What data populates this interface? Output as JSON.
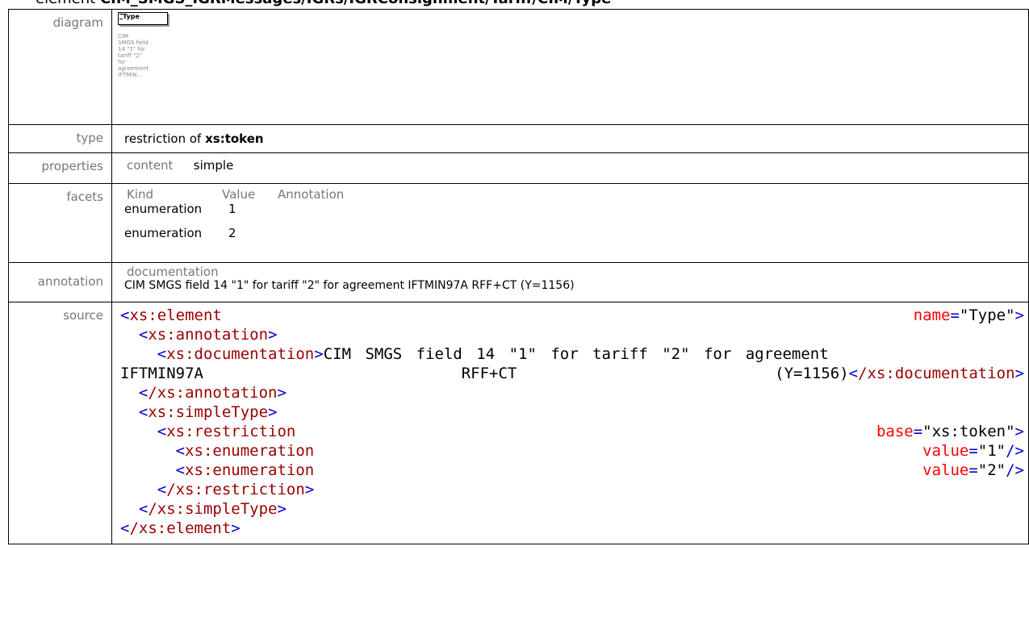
{
  "title": {
    "prefix": "element",
    "path": "CIM_SMGS_IGRMessages/IGRs/IGRConsignment/Tariff/CIM/Type"
  },
  "labels": {
    "diagram": "diagram",
    "type": "type",
    "properties": "properties",
    "facets": "facets",
    "annotation": "annotation",
    "source": "source"
  },
  "diagram": {
    "element_name": "Type",
    "doc_preview": "CIM\nSMGS field\n14 \"1\" for\ntariff \"2\"\nfor\nagreement\nIFTMIN..."
  },
  "type": {
    "prefix": "restriction of",
    "base": "xs:token"
  },
  "properties": {
    "key": "content",
    "value": "simple"
  },
  "facets": {
    "headers": [
      "Kind",
      "Value",
      "Annotation"
    ],
    "rows": [
      {
        "kind": "enumeration",
        "value": "1",
        "annotation": ""
      },
      {
        "kind": "enumeration",
        "value": "2",
        "annotation": ""
      }
    ]
  },
  "annotation": {
    "header": "documentation",
    "text": "CIM SMGS field 14 \"1\" for tariff \"2\" for agreement IFTMIN97A RFF+CT (Y=1156)"
  },
  "source": {
    "l1_tag": "xs:element",
    "l1_attr": "name",
    "l1_val": "\"Type\"",
    "l2_tag": "xs:annotation",
    "l3_tag": "xs:documentation",
    "l3_text": "CIM SMGS field 14 \"1\" for tariff \"2\" for agreement",
    "l4_a": "IFTMIN97A",
    "l4_b": "RFF+CT",
    "l4_c": "(Y=1156)",
    "l4_close": "/xs:documentation",
    "l5_close": "/xs:annotation",
    "l6_tag": "xs:simpleType",
    "l7_tag": "xs:restriction",
    "l7_attr": "base",
    "l7_val": "\"xs:token\"",
    "l8_tag": "xs:enumeration",
    "l8_attr": "value",
    "l8_val": "\"1\"",
    "l9_tag": "xs:enumeration",
    "l9_attr": "value",
    "l9_val": "\"2\"",
    "l10_close": "/xs:restriction",
    "l11_close": "/xs:simpleType",
    "l12_close": "/xs:element"
  }
}
